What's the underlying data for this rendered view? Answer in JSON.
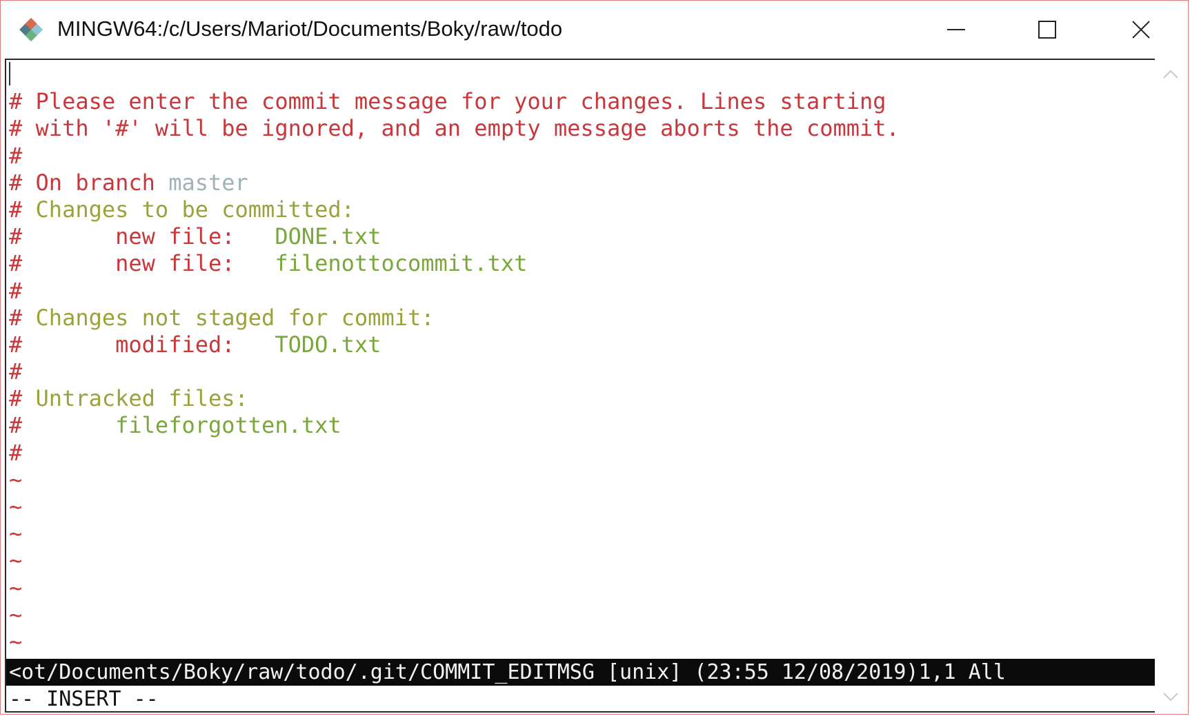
{
  "window": {
    "title": "MINGW64:/c/Users/Mariot/Documents/Boky/raw/todo",
    "controls": {
      "minimize": "minimize",
      "maximize": "maximize",
      "close": "close"
    }
  },
  "editor": {
    "lines": [
      {
        "segments": [],
        "cursor": true
      },
      {
        "segments": [
          {
            "text": "# Please enter the commit message for your changes. Lines starting",
            "color": "red"
          }
        ]
      },
      {
        "segments": [
          {
            "text": "# with '#' will be ignored, and an empty message aborts the commit.",
            "color": "red"
          }
        ]
      },
      {
        "segments": [
          {
            "text": "#",
            "color": "red"
          }
        ]
      },
      {
        "segments": [
          {
            "text": "# On branch ",
            "color": "red"
          },
          {
            "text": "master",
            "color": "gray"
          }
        ]
      },
      {
        "segments": [
          {
            "text": "# ",
            "color": "red"
          },
          {
            "text": "Changes to be committed:",
            "color": "olive"
          }
        ]
      },
      {
        "segments": [
          {
            "text": "#       new file:   ",
            "color": "red"
          },
          {
            "text": "DONE.txt",
            "color": "green"
          }
        ]
      },
      {
        "segments": [
          {
            "text": "#       new file:   ",
            "color": "red"
          },
          {
            "text": "filenottocommit.txt",
            "color": "green"
          }
        ]
      },
      {
        "segments": [
          {
            "text": "#",
            "color": "red"
          }
        ]
      },
      {
        "segments": [
          {
            "text": "# ",
            "color": "red"
          },
          {
            "text": "Changes not staged for commit:",
            "color": "olive"
          }
        ]
      },
      {
        "segments": [
          {
            "text": "#       modified:   ",
            "color": "red"
          },
          {
            "text": "TODO.txt",
            "color": "green"
          }
        ]
      },
      {
        "segments": [
          {
            "text": "#",
            "color": "red"
          }
        ]
      },
      {
        "segments": [
          {
            "text": "# ",
            "color": "red"
          },
          {
            "text": "Untracked files:",
            "color": "olive"
          }
        ]
      },
      {
        "segments": [
          {
            "text": "#       ",
            "color": "red"
          },
          {
            "text": "fileforgotten.txt",
            "color": "green"
          }
        ]
      },
      {
        "segments": [
          {
            "text": "#",
            "color": "red"
          }
        ]
      },
      {
        "segments": [
          {
            "text": "~",
            "color": "tilde"
          }
        ]
      },
      {
        "segments": [
          {
            "text": "~",
            "color": "tilde"
          }
        ]
      },
      {
        "segments": [
          {
            "text": "~",
            "color": "tilde"
          }
        ]
      },
      {
        "segments": [
          {
            "text": "~",
            "color": "tilde"
          }
        ]
      },
      {
        "segments": [
          {
            "text": "~",
            "color": "tilde"
          }
        ]
      },
      {
        "segments": [
          {
            "text": "~",
            "color": "tilde"
          }
        ]
      },
      {
        "segments": [
          {
            "text": "~",
            "color": "tilde"
          }
        ]
      }
    ]
  },
  "statusbar": {
    "text": "<ot/Documents/Boky/raw/todo/.git/COMMIT_EDITMSG [unix] (23:55 12/08/2019)1,1 All"
  },
  "modeline": {
    "text": "-- INSERT --"
  },
  "colors": {
    "red": "#c8373b",
    "olive": "#9aa23c",
    "green": "#79a83a",
    "gray": "#9fb3b6",
    "statusbar_bg": "#0b0b0b",
    "window_border": "#e07a7a"
  },
  "icons": {
    "app": "git-bash-icon",
    "scroll_up": "chevron-up-icon",
    "scroll_down": "chevron-down-icon"
  }
}
